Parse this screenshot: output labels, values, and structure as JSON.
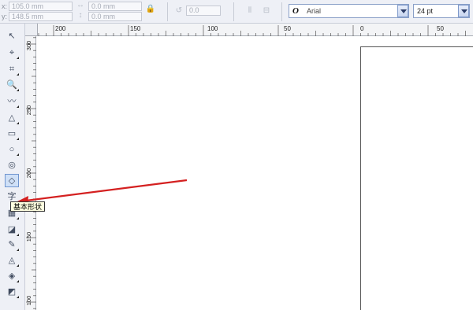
{
  "propbar": {
    "x_label": "x:",
    "x_value": "105.0 mm",
    "y_label": "y:",
    "y_value": "148.5 mm",
    "w_value": "0.0 mm",
    "h_value": "0.0 mm",
    "rotation_value": "0.0",
    "font_icon": "O",
    "font_name": "Arial",
    "font_size": "24 pt"
  },
  "hruler": {
    "ticks": [
      "200",
      "150",
      "100",
      "50",
      "0",
      "50"
    ]
  },
  "vruler": {
    "ticks": [
      "300",
      "250",
      "200",
      "150",
      "100"
    ]
  },
  "toolbox": {
    "tools": [
      {
        "name": "pick-tool",
        "glyph": "↖"
      },
      {
        "name": "shape-tool",
        "glyph": "⌖"
      },
      {
        "name": "crop-tool",
        "glyph": "⌗"
      },
      {
        "name": "zoom-tool",
        "glyph": "🔍"
      },
      {
        "name": "freehand-tool",
        "glyph": "〰"
      },
      {
        "name": "smart-fill-tool",
        "glyph": "△"
      },
      {
        "name": "rectangle-tool",
        "glyph": "▭"
      },
      {
        "name": "ellipse-tool",
        "glyph": "○"
      },
      {
        "name": "polygon-tool",
        "glyph": "◎"
      },
      {
        "name": "basic-shapes-tool",
        "glyph": "◇"
      },
      {
        "name": "text-tool",
        "glyph": "字"
      },
      {
        "name": "table-tool",
        "glyph": "▦"
      },
      {
        "name": "interactive-tool",
        "glyph": "◪"
      },
      {
        "name": "eyedropper-tool",
        "glyph": "✎"
      },
      {
        "name": "outline-tool",
        "glyph": "◬"
      },
      {
        "name": "fill-tool",
        "glyph": "◈"
      },
      {
        "name": "interactive-fill-tool",
        "glyph": "◩"
      }
    ]
  },
  "tooltip": {
    "text": "基本形状"
  },
  "colors": {
    "arrow": "#d42020",
    "selected_tool_bg": "#cfe0f7"
  }
}
